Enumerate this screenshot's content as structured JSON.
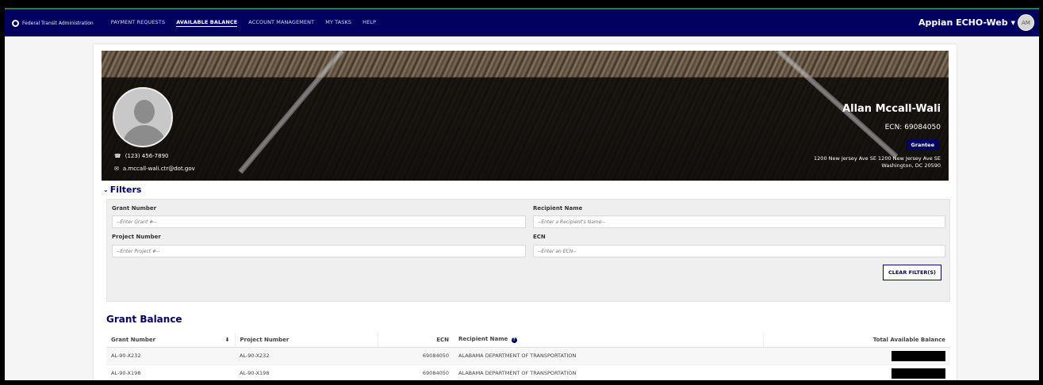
{
  "topnav": {
    "brand": "Federal Transit Administration",
    "items": [
      "PAYMENT REQUESTS",
      "AVAILABLE BALANCE",
      "ACCOUNT MANAGEMENT",
      "MY TASKS",
      "HELP"
    ],
    "app_name": "Appian ECHO-Web",
    "avatar_initials": "AM"
  },
  "profile": {
    "phone": "(123) 456-7890",
    "email": "a.mccall-wali.ctr@dot.gov",
    "name": "Allan Mccall-Wali",
    "ecn": "ECN: 69084050",
    "role": "Grantee",
    "address_line1": "1200 New Jersey Ave SE 1200 New Jersey Ave SE",
    "address_line2": "Washington, DC 20590"
  },
  "filters": {
    "title": "Filters",
    "grant_number_label": "Grant Number",
    "grant_number_placeholder": "--Enter Grant #--",
    "recipient_name_label": "Recipient Name",
    "recipient_name_placeholder": "--Enter a Recipient's Name--",
    "project_number_label": "Project Number",
    "project_number_placeholder": "--Enter Project #--",
    "ecn_label": "ECN",
    "ecn_placeholder": "--Enter an ECN--",
    "clear_label": "CLEAR FILTER(S)"
  },
  "grant_balance": {
    "title": "Grant Balance",
    "columns": [
      "Grant Number",
      "Project Number",
      "ECN",
      "Recipient Name",
      "Total Available Balance"
    ],
    "rows": [
      {
        "grant": "AL-90-X232",
        "project": "AL-90-X232",
        "ecn": "69084050",
        "recipient": "ALABAMA DEPARTMENT OF TRANSPORTATION"
      },
      {
        "grant": "AL-90-X198",
        "project": "AL-90-X198",
        "ecn": "69084050",
        "recipient": "ALABAMA DEPARTMENT OF TRANSPORTATION"
      }
    ]
  },
  "colors": {
    "primary": "#03015f",
    "accent_top": "#2e7d32"
  }
}
